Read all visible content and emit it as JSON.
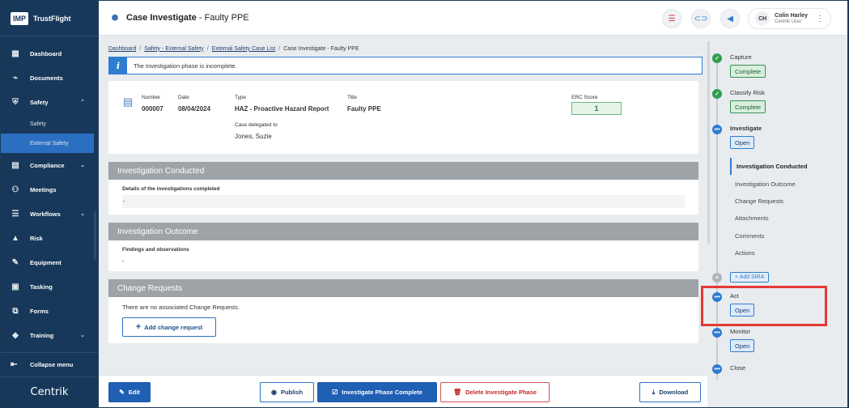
{
  "brand": {
    "logo": "IMP",
    "name": "TrustFlight"
  },
  "sidebar": {
    "items": [
      {
        "label": "Dashboard",
        "icon": "dashboard-icon",
        "glyph": "▦"
      },
      {
        "label": "Documents",
        "icon": "paperclip-icon",
        "glyph": "⌁"
      },
      {
        "label": "Safety",
        "icon": "shield-icon",
        "glyph": "⛨",
        "chevron": "⌃"
      },
      {
        "label": "Compliance",
        "icon": "clipboard-icon",
        "glyph": "▤",
        "chevron": "⌄"
      },
      {
        "label": "Meetings",
        "icon": "meetings-icon",
        "glyph": "⚇"
      },
      {
        "label": "Workflows",
        "icon": "workflow-icon",
        "glyph": "☰",
        "chevron": "⌄"
      },
      {
        "label": "Risk",
        "icon": "warning-icon",
        "glyph": "▲"
      },
      {
        "label": "Equipment",
        "icon": "wrench-icon",
        "glyph": "✎"
      },
      {
        "label": "Tasking",
        "icon": "tasking-icon",
        "glyph": "▣"
      },
      {
        "label": "Forms",
        "icon": "forms-icon",
        "glyph": "⧉"
      },
      {
        "label": "Training",
        "icon": "graduation-cap-icon",
        "glyph": "◆",
        "chevron": "⌄"
      }
    ],
    "safety_sub": [
      "Safety",
      "External Safety"
    ],
    "collapse_label": "Collapse menu",
    "footer_brand": "Centrik"
  },
  "header": {
    "title": "Case Investigate",
    "title_suffix": " - Faulty PPE",
    "user_initials": "CH",
    "user_name": "Colin Harley",
    "user_role": "Centrik User"
  },
  "breadcrumb": {
    "items": [
      "Dashboard",
      "Safety - External Safety",
      "External Safety Case List"
    ],
    "current": "Case Investigate - Faulty PPE"
  },
  "info": {
    "message": "The Investigation phase is incomplete."
  },
  "summary": {
    "number_label": "Number",
    "number": "000007",
    "date_label": "Date",
    "date": "08/04/2024",
    "type_label": "Type",
    "type": "HAZ - Proactive Hazard Report",
    "title_label": "Title",
    "title": "Faulty PPE",
    "erc_label": "ERC Score",
    "erc": "1",
    "delegated_label": "Case delegated to",
    "delegated": "Jones, Suzie"
  },
  "sections": {
    "conducted": {
      "title": "Investigation Conducted",
      "label": "Details of the investigations completed",
      "value": "-"
    },
    "outcome": {
      "title": "Investigation Outcome",
      "label": "Findings and observations",
      "value": "-"
    },
    "change": {
      "title": "Change Requests",
      "empty": "There are no associated Change Requests.",
      "add_label": "Add change request"
    }
  },
  "actions": {
    "edit": "Edit",
    "publish": "Publish",
    "complete": "Investigate Phase Complete",
    "delete": "Delete Investigate Phase",
    "download": "Download"
  },
  "timeline": {
    "capture": {
      "label": "Capture",
      "badge": "Complete"
    },
    "classify": {
      "label": "Classify Risk",
      "badge": "Complete"
    },
    "investigate": {
      "label": "Investigate",
      "badge": "Open"
    },
    "sub_items": [
      "Investigation Conducted",
      "Investigation Outcome",
      "Change Requests",
      "Attachments",
      "Comments",
      "Actions"
    ],
    "add_sira": "+ Add SIRA",
    "act": {
      "label": "Act",
      "badge": "Open"
    },
    "monitor": {
      "label": "Monitor",
      "badge": "Open"
    },
    "close": {
      "label": "Close"
    }
  },
  "colors": {
    "sidebar": "#17385a",
    "primary": "#1f5fb4",
    "success": "#2f9e4e",
    "danger": "#c62828",
    "highlight": "#e53935"
  }
}
